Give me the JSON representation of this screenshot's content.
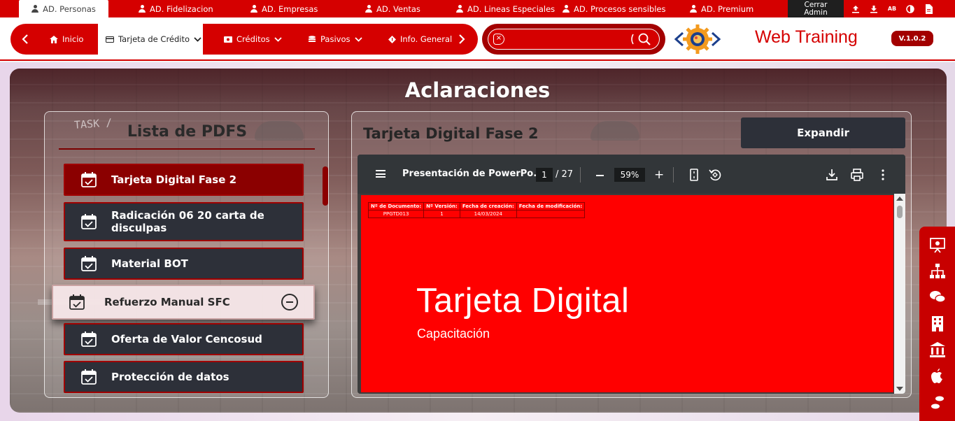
{
  "top_tabs": [
    {
      "label": "AD. Personas",
      "active": true
    },
    {
      "label": "AD. Fidelizacion"
    },
    {
      "label": "AD. Empresas"
    },
    {
      "label": "AD. Ventas"
    },
    {
      "label": "AD. Lineas Especiales"
    },
    {
      "label": "AD. Procesos sensibles"
    },
    {
      "label": "AD. Premium"
    }
  ],
  "admin": {
    "logout_label": "Cerrar Admin"
  },
  "top_icons": [
    "upload-icon",
    "download-icon",
    "font-size-icon",
    "contrast-icon",
    "document-icon"
  ],
  "top_font_label": "AB",
  "nav": {
    "items": [
      {
        "label": "Inicio",
        "icon": "home-icon"
      },
      {
        "label": "Tarjeta de Crédito",
        "icon": "credit-card-icon",
        "active": true,
        "dropdown": true
      },
      {
        "label": "Créditos",
        "icon": "money-icon",
        "dropdown": true
      },
      {
        "label": "Pasivos",
        "icon": "coins-icon",
        "dropdown": true
      },
      {
        "label": "Info. General",
        "icon": "info-icon"
      }
    ]
  },
  "search": {
    "placeholder": "",
    "value": ""
  },
  "brand": {
    "name": "Web Training",
    "version": "V.1.0.2"
  },
  "page": {
    "title": "Aclaraciones"
  },
  "pdf_list": {
    "title": "Lista de PDFS",
    "items": [
      {
        "label": "Tarjeta Digital Fase 2",
        "active": true
      },
      {
        "label": "Radicación 06 20 carta de disculpas"
      },
      {
        "label": "Material BOT"
      },
      {
        "label": "Refuerzo Manual SFC",
        "hovered": true
      },
      {
        "label": "Oferta de Valor Cencosud"
      },
      {
        "label": "Protección de datos"
      }
    ]
  },
  "viewer": {
    "title": "Tarjeta Digital Fase 2",
    "expand_label": "Expandir",
    "doc_name": "Presentación de PowerPo...",
    "page": "1",
    "total_pages": "/ 27",
    "zoom": "59%",
    "slide": {
      "table_headers": [
        "Nº de Documento:",
        "Nº Versión:",
        "Fecha de creación:",
        "Fecha de modificación:"
      ],
      "table_values": [
        "PPGTD013",
        "1",
        "14/03/2024",
        ""
      ],
      "title": "Tarjeta Digital",
      "subtitle": "Capacitación",
      "bg_color": "#ff0000"
    }
  },
  "side_icons": [
    "presentation-icon",
    "org-chart-icon",
    "chat-icon",
    "building-icon",
    "bank-icon",
    "apple-icon",
    "footprints-icon"
  ],
  "colors": {
    "primary": "#d50000",
    "dark": "#2d3039",
    "accent_dark": "#8b0000"
  }
}
